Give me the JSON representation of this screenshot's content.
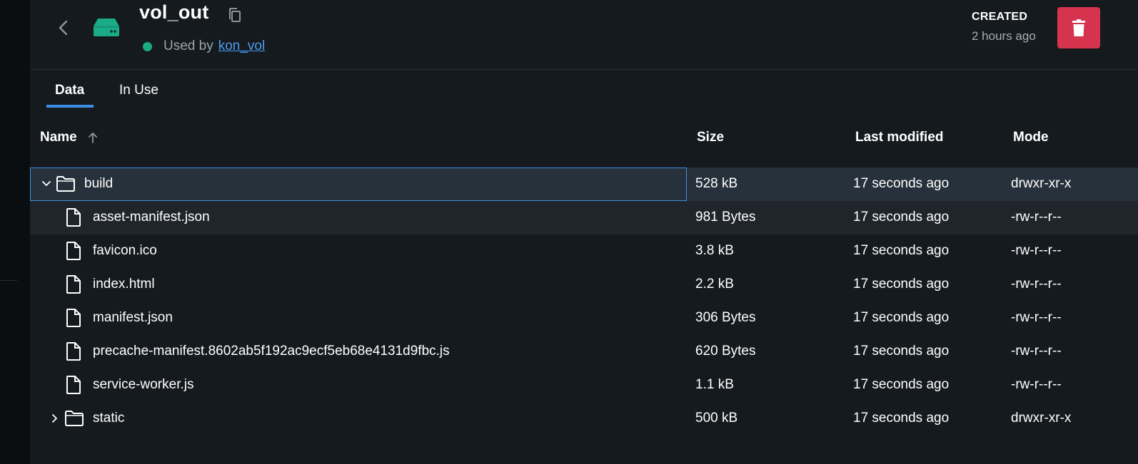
{
  "header": {
    "title": "vol_out",
    "used_by_prefix": "Used by",
    "used_by_link": "kon_vol",
    "created_label": "CREATED",
    "created_value": "2 hours ago",
    "status_color": "#1bab86",
    "delete_color": "#d6334e"
  },
  "tabs": [
    {
      "label": "Data",
      "active": true
    },
    {
      "label": "In Use",
      "active": false
    }
  ],
  "table": {
    "columns": {
      "name": "Name",
      "size": "Size",
      "modified": "Last modified",
      "mode": "Mode"
    },
    "sort": "ascending",
    "rows": [
      {
        "name": "build",
        "type": "folder",
        "expanded": true,
        "size": "528 kB",
        "modified": "17 seconds ago",
        "mode": "drwxr-xr-x"
      },
      {
        "name": "asset-manifest.json",
        "type": "file",
        "size": "981 Bytes",
        "modified": "17 seconds ago",
        "mode": "-rw-r--r--"
      },
      {
        "name": "favicon.ico",
        "type": "file",
        "size": "3.8 kB",
        "modified": "17 seconds ago",
        "mode": "-rw-r--r--"
      },
      {
        "name": "index.html",
        "type": "file",
        "size": "2.2 kB",
        "modified": "17 seconds ago",
        "mode": "-rw-r--r--"
      },
      {
        "name": "manifest.json",
        "type": "file",
        "size": "306 Bytes",
        "modified": "17 seconds ago",
        "mode": "-rw-r--r--"
      },
      {
        "name": "precache-manifest.8602ab5f192ac9ecf5eb68e4131d9fbc.js",
        "type": "file",
        "size": "620 Bytes",
        "modified": "17 seconds ago",
        "mode": "-rw-r--r--"
      },
      {
        "name": "service-worker.js",
        "type": "file",
        "size": "1.1 kB",
        "modified": "17 seconds ago",
        "mode": "-rw-r--r--"
      },
      {
        "name": "static",
        "type": "folder",
        "expanded": false,
        "size": "500 kB",
        "modified": "17 seconds ago",
        "mode": "drwxr-xr-x"
      }
    ]
  }
}
